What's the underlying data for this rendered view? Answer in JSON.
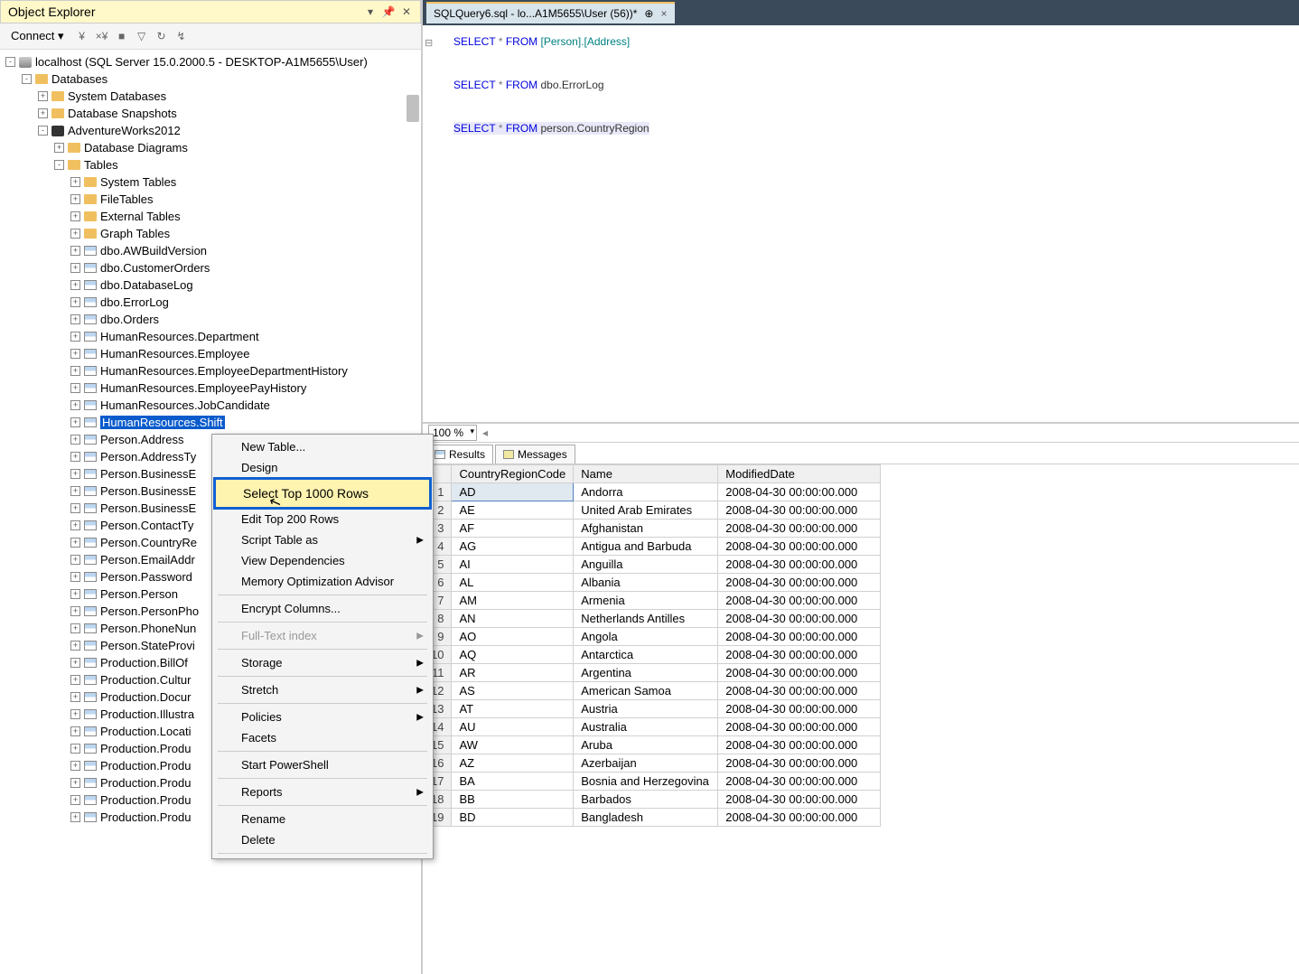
{
  "objectExplorer": {
    "title": "Object Explorer",
    "connectLabel": "Connect ▾",
    "server": "localhost (SQL Server 15.0.2000.5 - DESKTOP-A1M5655\\User)",
    "databasesLabel": "Databases",
    "systemDatabases": "System Databases",
    "databaseSnapshots": "Database Snapshots",
    "currentDb": "AdventureWorks2012",
    "databaseDiagrams": "Database Diagrams",
    "tablesLabel": "Tables",
    "tableFolders": [
      "System Tables",
      "FileTables",
      "External Tables",
      "Graph Tables"
    ],
    "tables": [
      "dbo.AWBuildVersion",
      "dbo.CustomerOrders",
      "dbo.DatabaseLog",
      "dbo.ErrorLog",
      "dbo.Orders",
      "HumanResources.Department",
      "HumanResources.Employee",
      "HumanResources.EmployeeDepartmentHistory",
      "HumanResources.EmployeePayHistory",
      "HumanResources.JobCandidate",
      "HumanResources.Shift",
      "Person.Address",
      "Person.AddressTy",
      "Person.BusinessE",
      "Person.BusinessE",
      "Person.BusinessE",
      "Person.ContactTy",
      "Person.CountryRe",
      "Person.EmailAddr",
      "Person.Password",
      "Person.Person",
      "Person.PersonPho",
      "Person.PhoneNun",
      "Person.StateProvi",
      "Production.BillOf",
      "Production.Cultur",
      "Production.Docur",
      "Production.Illustra",
      "Production.Locati",
      "Production.Produ",
      "Production.Produ",
      "Production.Produ",
      "Production.Produ",
      "Production.Produ"
    ],
    "selectedTableIndex": 10
  },
  "contextMenu": {
    "items": [
      {
        "label": "New Table...",
        "sep": false
      },
      {
        "label": "Design",
        "sep": false
      },
      {
        "label": "Select Top 1000 Rows",
        "sep": false,
        "highlight": true
      },
      {
        "label": "Edit Top 200 Rows",
        "sep": false
      },
      {
        "label": "Script Table as",
        "sep": false,
        "sub": true
      },
      {
        "label": "View Dependencies",
        "sep": false
      },
      {
        "label": "Memory Optimization Advisor",
        "sep": false
      },
      {
        "sep": true
      },
      {
        "label": "Encrypt Columns...",
        "sep": false
      },
      {
        "sep": true
      },
      {
        "label": "Full-Text index",
        "sep": false,
        "sub": true,
        "disabled": true
      },
      {
        "sep": true
      },
      {
        "label": "Storage",
        "sep": false,
        "sub": true
      },
      {
        "sep": true
      },
      {
        "label": "Stretch",
        "sep": false,
        "sub": true
      },
      {
        "sep": true
      },
      {
        "label": "Policies",
        "sep": false,
        "sub": true
      },
      {
        "label": "Facets",
        "sep": false
      },
      {
        "sep": true
      },
      {
        "label": "Start PowerShell",
        "sep": false
      },
      {
        "sep": true
      },
      {
        "label": "Reports",
        "sep": false,
        "sub": true
      },
      {
        "sep": true
      },
      {
        "label": "Rename",
        "sep": false
      },
      {
        "label": "Delete",
        "sep": false
      },
      {
        "sep": true
      }
    ]
  },
  "editorTab": {
    "title": "SQLQuery6.sql - lo...A1M5655\\User (56))*",
    "pinGlyph": "⊕",
    "closeGlyph": "×"
  },
  "sql": {
    "line1_kw1": "SELECT",
    "line1_star": "*",
    "line1_kw2": "FROM",
    "line1_obj": "[Person].[Address]",
    "line2_kw1": "SELECT",
    "line2_star": "*",
    "line2_kw2": "FROM",
    "line2_obj": "dbo.ErrorLog",
    "line3_kw1": "SELECT",
    "line3_star": "*",
    "line3_kw2": "FROM",
    "line3_obj": "person.CountryRegion"
  },
  "zoom": {
    "value": "100 %"
  },
  "resultsTabs": {
    "results": "Results",
    "messages": "Messages"
  },
  "grid": {
    "headers": [
      "",
      "CountryRegionCode",
      "Name",
      "ModifiedDate"
    ],
    "rows": [
      [
        "1",
        "AD",
        "Andorra",
        "2008-04-30 00:00:00.000"
      ],
      [
        "2",
        "AE",
        "United Arab Emirates",
        "2008-04-30 00:00:00.000"
      ],
      [
        "3",
        "AF",
        "Afghanistan",
        "2008-04-30 00:00:00.000"
      ],
      [
        "4",
        "AG",
        "Antigua and Barbuda",
        "2008-04-30 00:00:00.000"
      ],
      [
        "5",
        "AI",
        "Anguilla",
        "2008-04-30 00:00:00.000"
      ],
      [
        "6",
        "AL",
        "Albania",
        "2008-04-30 00:00:00.000"
      ],
      [
        "7",
        "AM",
        "Armenia",
        "2008-04-30 00:00:00.000"
      ],
      [
        "8",
        "AN",
        "Netherlands Antilles",
        "2008-04-30 00:00:00.000"
      ],
      [
        "9",
        "AO",
        "Angola",
        "2008-04-30 00:00:00.000"
      ],
      [
        "10",
        "AQ",
        "Antarctica",
        "2008-04-30 00:00:00.000"
      ],
      [
        "11",
        "AR",
        "Argentina",
        "2008-04-30 00:00:00.000"
      ],
      [
        "12",
        "AS",
        "American Samoa",
        "2008-04-30 00:00:00.000"
      ],
      [
        "13",
        "AT",
        "Austria",
        "2008-04-30 00:00:00.000"
      ],
      [
        "14",
        "AU",
        "Australia",
        "2008-04-30 00:00:00.000"
      ],
      [
        "15",
        "AW",
        "Aruba",
        "2008-04-30 00:00:00.000"
      ],
      [
        "16",
        "AZ",
        "Azerbaijan",
        "2008-04-30 00:00:00.000"
      ],
      [
        "17",
        "BA",
        "Bosnia and Herzegovina",
        "2008-04-30 00:00:00.000"
      ],
      [
        "18",
        "BB",
        "Barbados",
        "2008-04-30 00:00:00.000"
      ],
      [
        "19",
        "BD",
        "Bangladesh",
        "2008-04-30 00:00:00.000"
      ]
    ]
  }
}
